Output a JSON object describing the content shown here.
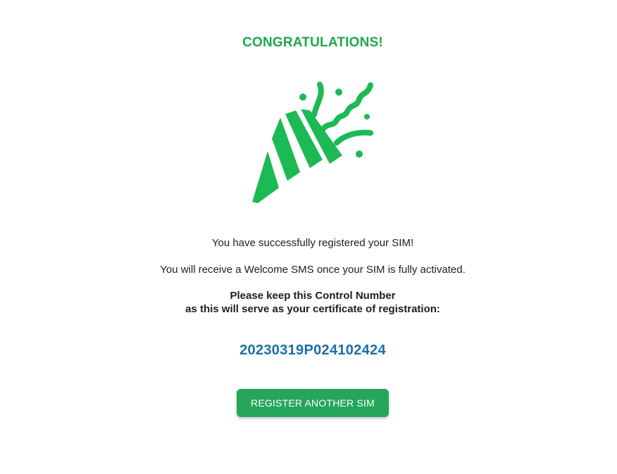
{
  "header": {
    "title": "CONGRATULATIONS!"
  },
  "illustration": {
    "icon": "party-popper-icon"
  },
  "messages": {
    "registered": "You have successfully registered your SIM!",
    "welcome_sms": "You will receive a Welcome SMS once your SIM is fully activated.",
    "keep_control_line1": "Please keep this Control Number",
    "keep_control_line2": "as this will serve as your certificate of registration:"
  },
  "control_number": "20230319P024102424",
  "actions": {
    "register_another_label": "REGISTER ANOTHER SIM"
  },
  "colors": {
    "brand_green": "#1db954",
    "title_green": "#1ea84a",
    "button_green": "#26a65b",
    "control_blue": "#1b6fa8"
  }
}
